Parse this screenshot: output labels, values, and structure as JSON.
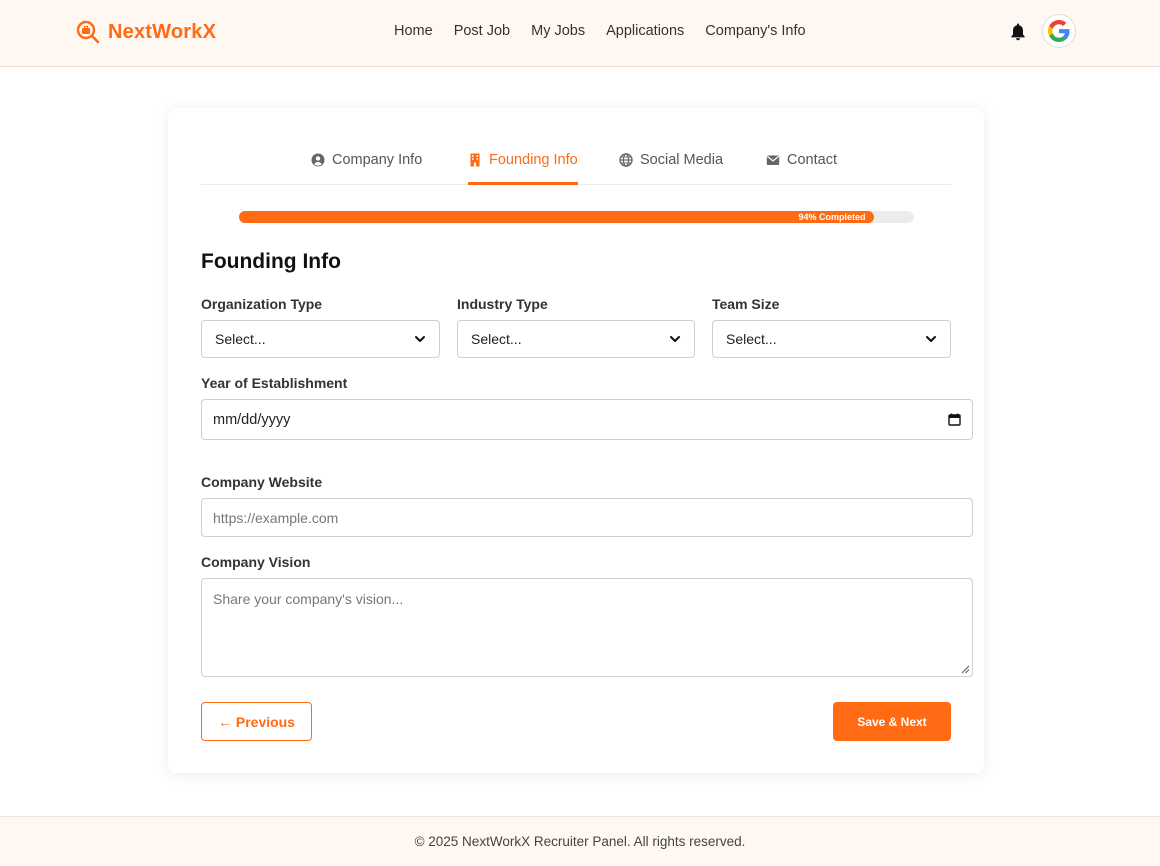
{
  "header": {
    "brand": "NextWorkX",
    "nav": [
      "Home",
      "Post Job",
      "My Jobs",
      "Applications",
      "Company's Info"
    ],
    "icons": {
      "brand": "search-briefcase-icon",
      "notification": "bell-icon",
      "avatar": "google-logo-icon"
    }
  },
  "tabs": [
    {
      "label": "Company Info",
      "icon": "user-circle-icon",
      "active": false
    },
    {
      "label": "Founding Info",
      "icon": "building-icon",
      "active": true
    },
    {
      "label": "Social Media",
      "icon": "globe-icon",
      "active": false
    },
    {
      "label": "Contact",
      "icon": "envelope-icon",
      "active": false
    }
  ],
  "progress": {
    "value": 0.94,
    "label": "94% Completed"
  },
  "form": {
    "title": "Founding Info",
    "org_type": {
      "label": "Organization Type",
      "value": "Select..."
    },
    "industry_type": {
      "label": "Industry Type",
      "value": "Select..."
    },
    "team_size": {
      "label": "Team Size",
      "value": "Select..."
    },
    "year": {
      "label": "Year of Establishment",
      "value": "mm/dd/yyyy"
    },
    "website": {
      "label": "Company Website",
      "placeholder": "https://example.com"
    },
    "vision": {
      "label": "Company Vision",
      "placeholder": "Share your company's vision..."
    }
  },
  "buttons": {
    "previous": "← Previous",
    "next": "Save & Next"
  },
  "footer": "© 2025 NextWorkX Recruiter Panel. All rights reserved.",
  "colors": {
    "accent": "#ff6a13",
    "header_bg": "#fff8f2"
  }
}
